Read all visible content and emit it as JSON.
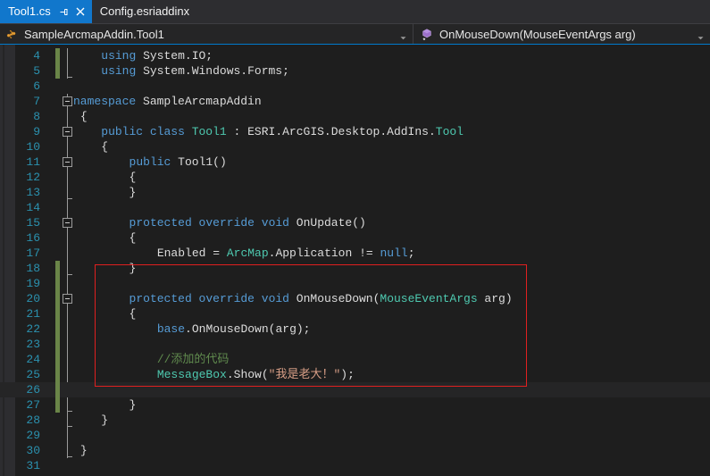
{
  "window": {
    "theme_background": "#1e1e1e",
    "accent_color": "#007acc"
  },
  "tabs": {
    "items": [
      {
        "label": "Tool1.cs",
        "active": true,
        "pin_icon": "pin-icon",
        "close_icon": "close-icon"
      },
      {
        "label": "Config.esriaddinx",
        "active": false
      }
    ]
  },
  "navbar": {
    "type_dropdown": {
      "icon": "class-icon",
      "value": "SampleArcmapAddin.Tool1",
      "arrow_icon": "chevron-down-icon"
    },
    "member_dropdown": {
      "icon": "method-icon",
      "value": "OnMouseDown(MouseEventArgs arg)",
      "arrow_icon": "chevron-down-icon"
    }
  },
  "editor": {
    "first_visible_line": 4,
    "current_line": 26,
    "annotation": {
      "shape": "rectangle",
      "color": "#e02020",
      "covers_lines": "19-27"
    },
    "lines": [
      {
        "n": 4,
        "indent": 4,
        "changed": true,
        "fold": null,
        "tokens": [
          {
            "t": "using",
            "c": "kw"
          },
          {
            "t": " System.IO;",
            "c": "pln"
          }
        ]
      },
      {
        "n": 5,
        "indent": 4,
        "changed": true,
        "fold": null,
        "tokens": [
          {
            "t": "using",
            "c": "kw"
          },
          {
            "t": " System.Windows.Forms;",
            "c": "pln"
          }
        ]
      },
      {
        "n": 6,
        "indent": 0,
        "changed": false,
        "fold": null,
        "tokens": []
      },
      {
        "n": 7,
        "indent": 0,
        "changed": false,
        "fold": "collapse",
        "tokens": [
          {
            "t": "namespace",
            "c": "kw"
          },
          {
            "t": " SampleArcmapAddin",
            "c": "pln"
          }
        ]
      },
      {
        "n": 8,
        "indent": 1,
        "changed": false,
        "fold": null,
        "tokens": [
          {
            "t": "{",
            "c": "pln"
          }
        ]
      },
      {
        "n": 9,
        "indent": 4,
        "changed": false,
        "fold": "collapse",
        "tokens": [
          {
            "t": "public class",
            "c": "kw"
          },
          {
            "t": " ",
            "c": "pln"
          },
          {
            "t": "Tool1",
            "c": "typ"
          },
          {
            "t": " : ESRI.ArcGIS.Desktop.AddIns.",
            "c": "pln"
          },
          {
            "t": "Tool",
            "c": "typ"
          }
        ]
      },
      {
        "n": 10,
        "indent": 4,
        "changed": false,
        "fold": null,
        "tokens": [
          {
            "t": "{",
            "c": "pln"
          }
        ]
      },
      {
        "n": 11,
        "indent": 8,
        "changed": false,
        "fold": "collapse",
        "tokens": [
          {
            "t": "public",
            "c": "kw"
          },
          {
            "t": " Tool1()",
            "c": "pln"
          }
        ]
      },
      {
        "n": 12,
        "indent": 8,
        "changed": false,
        "fold": null,
        "tokens": [
          {
            "t": "{",
            "c": "pln"
          }
        ]
      },
      {
        "n": 13,
        "indent": 8,
        "changed": false,
        "fold": null,
        "tokens": [
          {
            "t": "}",
            "c": "pln"
          }
        ]
      },
      {
        "n": 14,
        "indent": 0,
        "changed": false,
        "fold": null,
        "tokens": []
      },
      {
        "n": 15,
        "indent": 8,
        "changed": false,
        "fold": "collapse",
        "tokens": [
          {
            "t": "protected override void",
            "c": "kw"
          },
          {
            "t": " OnUpdate()",
            "c": "pln"
          }
        ]
      },
      {
        "n": 16,
        "indent": 8,
        "changed": false,
        "fold": null,
        "tokens": [
          {
            "t": "{",
            "c": "pln"
          }
        ]
      },
      {
        "n": 17,
        "indent": 12,
        "changed": false,
        "fold": null,
        "tokens": [
          {
            "t": "Enabled = ",
            "c": "pln"
          },
          {
            "t": "ArcMap",
            "c": "typ"
          },
          {
            "t": ".Application != ",
            "c": "pln"
          },
          {
            "t": "null",
            "c": "kw"
          },
          {
            "t": ";",
            "c": "pln"
          }
        ]
      },
      {
        "n": 18,
        "indent": 8,
        "changed": true,
        "fold": null,
        "tokens": [
          {
            "t": "}",
            "c": "pln"
          }
        ]
      },
      {
        "n": 19,
        "indent": 0,
        "changed": true,
        "fold": null,
        "tokens": []
      },
      {
        "n": 20,
        "indent": 8,
        "changed": true,
        "fold": "collapse",
        "tokens": [
          {
            "t": "protected override void",
            "c": "kw"
          },
          {
            "t": " OnMouseDown(",
            "c": "pln"
          },
          {
            "t": "MouseEventArgs",
            "c": "typ"
          },
          {
            "t": " arg)",
            "c": "pln"
          }
        ]
      },
      {
        "n": 21,
        "indent": 8,
        "changed": true,
        "fold": null,
        "tokens": [
          {
            "t": "{",
            "c": "pln"
          }
        ]
      },
      {
        "n": 22,
        "indent": 12,
        "changed": true,
        "fold": null,
        "tokens": [
          {
            "t": "base",
            "c": "kw"
          },
          {
            "t": ".OnMouseDown(arg);",
            "c": "pln"
          }
        ]
      },
      {
        "n": 23,
        "indent": 0,
        "changed": true,
        "fold": null,
        "tokens": []
      },
      {
        "n": 24,
        "indent": 12,
        "changed": true,
        "fold": null,
        "tokens": [
          {
            "t": "//添加的代码",
            "c": "cmt"
          }
        ]
      },
      {
        "n": 25,
        "indent": 12,
        "changed": true,
        "fold": null,
        "tokens": [
          {
            "t": "MessageBox",
            "c": "typ"
          },
          {
            "t": ".Show(",
            "c": "pln"
          },
          {
            "t": "\"我是老大！\"",
            "c": "str"
          },
          {
            "t": ");",
            "c": "pln"
          }
        ]
      },
      {
        "n": 26,
        "indent": 0,
        "changed": true,
        "fold": null,
        "tokens": []
      },
      {
        "n": 27,
        "indent": 8,
        "changed": true,
        "fold": null,
        "tokens": [
          {
            "t": "}",
            "c": "pln"
          }
        ]
      },
      {
        "n": 28,
        "indent": 4,
        "changed": false,
        "fold": null,
        "tokens": [
          {
            "t": "}",
            "c": "pln"
          }
        ]
      },
      {
        "n": 29,
        "indent": 0,
        "changed": false,
        "fold": null,
        "tokens": []
      },
      {
        "n": 30,
        "indent": 1,
        "changed": false,
        "fold": null,
        "tokens": [
          {
            "t": "}",
            "c": "pln"
          }
        ]
      },
      {
        "n": 31,
        "indent": 0,
        "changed": false,
        "fold": null,
        "tokens": []
      }
    ]
  }
}
